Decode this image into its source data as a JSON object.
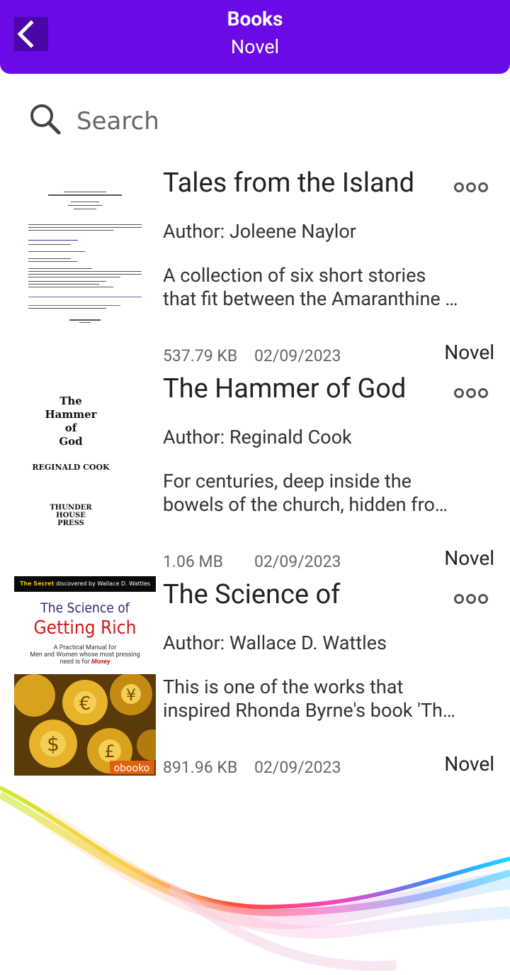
{
  "header": {
    "title": "Books",
    "subtitle": "Novel",
    "background": "#6a0ae6"
  },
  "search": {
    "placeholder": "Search"
  },
  "books": [
    {
      "title": "Tales from the Island",
      "author": "Author: Joleene Naylor",
      "description_lines": [
        "A collection of six short stories",
        "that fit between the Amaranthine …"
      ],
      "size": "537.79 KB",
      "date": "02/09/2023",
      "category": "Novel"
    },
    {
      "title": "The Hammer of God",
      "author": "Author: Reginald Cook",
      "description_lines": [
        "For centuries, deep inside the",
        "bowels of the church, hidden fro…"
      ],
      "size": "1.06 MB",
      "date": "02/09/2023",
      "category": "Novel",
      "cover": {
        "line1": "The",
        "line2": "Hammer",
        "line3": "of",
        "line4": "God",
        "author": "REGINALD COOK",
        "pub1": "THUNDER",
        "pub2": "HOUSE",
        "pub3": "PRESS"
      }
    },
    {
      "title": "The Science of",
      "author": "Author: Wallace D. Wattles",
      "description_lines": [
        "This is one of the works that",
        "inspired Rhonda Byrne's book 'Th…"
      ],
      "size": "891.96 KB",
      "date": "02/09/2023",
      "category": "Novel",
      "cover": {
        "banner_a": "The Secret",
        "banner_b": " discovered by Wallace D. Wattles",
        "title_line1": "The Science of",
        "title_line2": "Getting Rich",
        "tag1": "A Practical Manual for",
        "tag2": "Men and Women whose most pressing",
        "tag3a": "need is for ",
        "tag3b": "Money",
        "publisher": "obooko"
      }
    }
  ]
}
